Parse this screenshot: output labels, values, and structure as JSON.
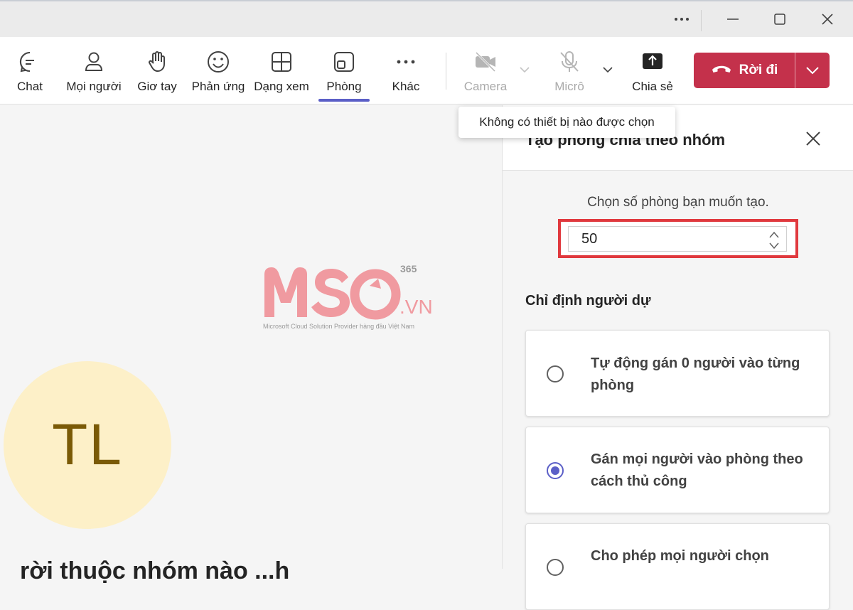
{
  "toolbar": {
    "items": [
      {
        "label": "Chat",
        "icon": "chat-icon"
      },
      {
        "label": "Mọi người",
        "icon": "people-icon"
      },
      {
        "label": "Giơ tay",
        "icon": "raise-hand-icon"
      },
      {
        "label": "Phản ứng",
        "icon": "smiley-icon"
      },
      {
        "label": "Dạng xem",
        "icon": "grid-view-icon"
      },
      {
        "label": "Phòng",
        "icon": "rooms-icon",
        "active": true
      },
      {
        "label": "Khác",
        "icon": "more-icon"
      },
      {
        "label": "Camera",
        "icon": "camera-off-icon",
        "disabled": true
      },
      {
        "label": "Micrô",
        "icon": "mic-off-icon",
        "disabled": true
      },
      {
        "label": "Chia sẻ",
        "icon": "share-icon"
      }
    ],
    "leave_label": "Rời đi"
  },
  "tooltip": "Không có thiết bị nào được chọn",
  "panel": {
    "title": "Tạo phòng chia theo nhóm",
    "count_label": "Chọn số phòng bạn muốn tạo.",
    "count_value": "50",
    "assign_label": "Chỉ định người dự",
    "options": [
      {
        "label": "Tự động gán 0 người vào từng phòng",
        "checked": false
      },
      {
        "label": "Gán mọi người vào phòng theo cách thủ công",
        "checked": true
      },
      {
        "label": "Cho phép mọi người chọn",
        "checked": false
      }
    ]
  },
  "participant": {
    "initials": "TL",
    "name_partial": "rời thuộc nhóm nào ...h"
  },
  "watermark": {
    "brand": "MSO",
    "sup": "365",
    "domain": ".VN",
    "tagline": "Microsoft Cloud Solution Provider hàng đầu Việt Nam"
  },
  "colors": {
    "accent": "#5b5fc7",
    "leave": "#c4314b",
    "highlight": "#e0393e",
    "avatar_bg": "#fdf0c8"
  }
}
